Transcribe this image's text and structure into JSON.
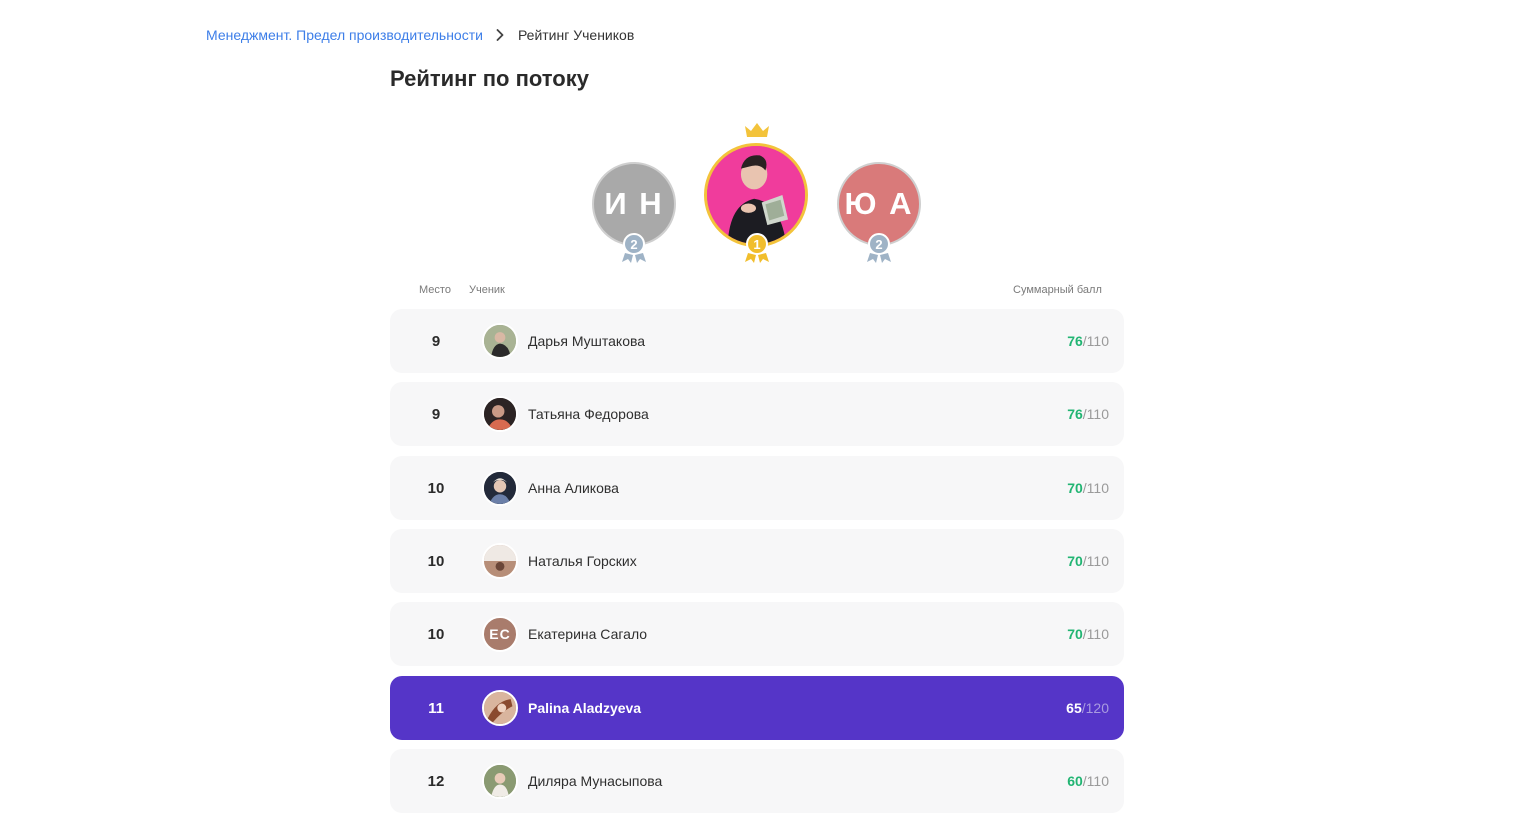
{
  "breadcrumb": {
    "course": "Менеджмент. Предел производительности",
    "current": "Рейтинг Учеников"
  },
  "title": "Рейтинг по потоку",
  "podium": {
    "left": {
      "initials": "И Н",
      "place": "2"
    },
    "center": {
      "place": "1"
    },
    "right": {
      "initials": "Ю А",
      "place": "2"
    }
  },
  "table": {
    "col_place": "Место",
    "col_student": "Ученик",
    "col_score": "Суммарный балл"
  },
  "rows": [
    {
      "place": "9",
      "name": "Дарья Муштакова",
      "score": "76",
      "max": "110",
      "avatar": "photo",
      "avatar_color": "#8c9a7a"
    },
    {
      "place": "9",
      "name": "Татьяна Федорова",
      "score": "76",
      "max": "110",
      "avatar": "photo",
      "avatar_color": "#3a3030"
    },
    {
      "place": "10",
      "name": "Анна Аликова",
      "score": "70",
      "max": "110",
      "avatar": "photo",
      "avatar_color": "#2d3445"
    },
    {
      "place": "10",
      "name": "Наталья Горских",
      "score": "70",
      "max": "110",
      "avatar": "photo",
      "avatar_color": "#c9a99a"
    },
    {
      "place": "10",
      "name": "Екатерина Сагало",
      "score": "70",
      "max": "110",
      "avatar": "initials",
      "initials": "ЕС",
      "avatar_color": "#a97c6c"
    },
    {
      "place": "11",
      "name": "Palina Aladzyeva",
      "score": "65",
      "max": "120",
      "avatar": "photo",
      "avatar_color": "#b8876c",
      "current": true
    },
    {
      "place": "12",
      "name": "Диляра Мунасыпова",
      "score": "60",
      "max": "110",
      "avatar": "photo",
      "avatar_color": "#7f8f6a"
    }
  ],
  "colors": {
    "link": "#3d7ee8",
    "score_green": "#22b573",
    "current_row": "#5535c8",
    "gold": "#f3c33b",
    "silver": "#9fb3c6"
  }
}
